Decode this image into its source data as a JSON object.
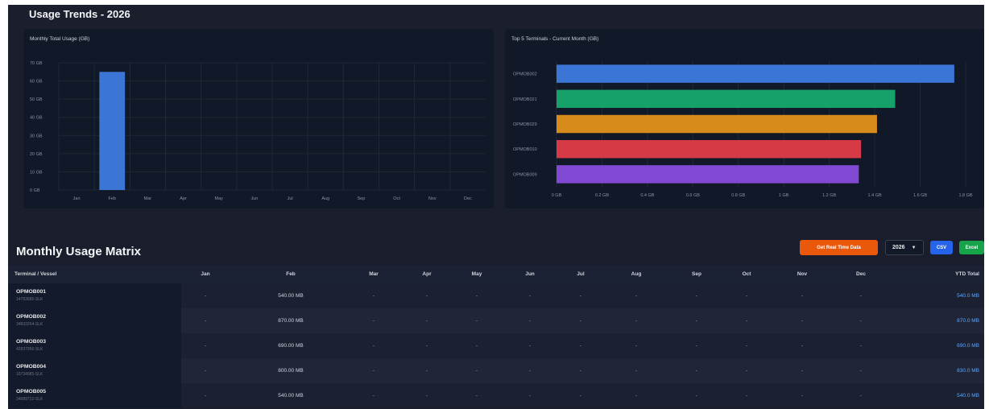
{
  "trends": {
    "title": "Usage Trends - 2026"
  },
  "chart_data": [
    {
      "type": "bar",
      "title": "Monthly Total Usage (GB)",
      "categories": [
        "Jan",
        "Feb",
        "Mar",
        "Apr",
        "May",
        "Jun",
        "Jul",
        "Aug",
        "Sep",
        "Oct",
        "Nov",
        "Dec"
      ],
      "values": [
        0,
        65,
        0,
        0,
        0,
        0,
        0,
        0,
        0,
        0,
        0,
        0
      ],
      "ylim": [
        0,
        70
      ],
      "yticks": [
        "0 GB",
        "10 GB",
        "20 GB",
        "30 GB",
        "40 GB",
        "50 GB",
        "60 GB",
        "70 GB"
      ],
      "color": "#3b76d6",
      "grid": true
    },
    {
      "type": "bar",
      "orientation": "horizontal",
      "title": "Top 5 Terminals - Current Month (GB)",
      "categories": [
        "OPMOB002",
        "OPMOB021",
        "OPMOB029",
        "OPMOB010",
        "OPMOB009"
      ],
      "values": [
        1.75,
        1.49,
        1.41,
        1.34,
        1.33
      ],
      "colors": [
        "#3b76d6",
        "#16a06a",
        "#d68b1a",
        "#d63a47",
        "#8148d3"
      ],
      "xlim": [
        0,
        1.8
      ],
      "xticks": [
        "0 GB",
        "0.2 GB",
        "0.4 GB",
        "0.6 GB",
        "0.8 GB",
        "1 GB",
        "1.2 GB",
        "1.4 GB",
        "1.6 GB",
        "1.8 GB"
      ],
      "grid": true
    }
  ],
  "matrix": {
    "title": "Monthly Usage Matrix",
    "realtime_label": "Get Real Time Data",
    "year_selected": "2026",
    "csv_label": "CSV",
    "excel_label": "Excel",
    "columns": [
      "Terminal / Vessel",
      "Jan",
      "Feb",
      "Mar",
      "Apr",
      "May",
      "Jun",
      "Jul",
      "Aug",
      "Sep",
      "Oct",
      "Nov",
      "Dec",
      "YTD Total"
    ],
    "rows": [
      {
        "name": "OPMOB001",
        "sub": "14783685-SLK",
        "cells": [
          "-",
          "540.00 MB",
          "-",
          "-",
          "-",
          "-",
          "-",
          "-",
          "-",
          "-",
          "-",
          "-"
        ],
        "ytd": "540.0 MB"
      },
      {
        "name": "OPMOB002",
        "sub": "34833264-SLK",
        "cells": [
          "-",
          "870.00 MB",
          "-",
          "-",
          "-",
          "-",
          "-",
          "-",
          "-",
          "-",
          "-",
          "-"
        ],
        "ytd": "870.0 MB"
      },
      {
        "name": "OPMOB003",
        "sub": "42837956-SLK",
        "cells": [
          "-",
          "690.00 MB",
          "-",
          "-",
          "-",
          "-",
          "-",
          "-",
          "-",
          "-",
          "-",
          "-"
        ],
        "ytd": "690.0 MB"
      },
      {
        "name": "OPMOB004",
        "sub": "16734985-SLK",
        "cells": [
          "-",
          "800.00 MB",
          "-",
          "-",
          "-",
          "-",
          "-",
          "-",
          "-",
          "-",
          "-",
          "-"
        ],
        "ytd": "830.0 MB"
      },
      {
        "name": "OPMOB005",
        "sub": "34689712-SLK",
        "cells": [
          "-",
          "540.00 MB",
          "-",
          "-",
          "-",
          "-",
          "-",
          "-",
          "-",
          "-",
          "-",
          "-"
        ],
        "ytd": "540.0 MB"
      }
    ]
  }
}
